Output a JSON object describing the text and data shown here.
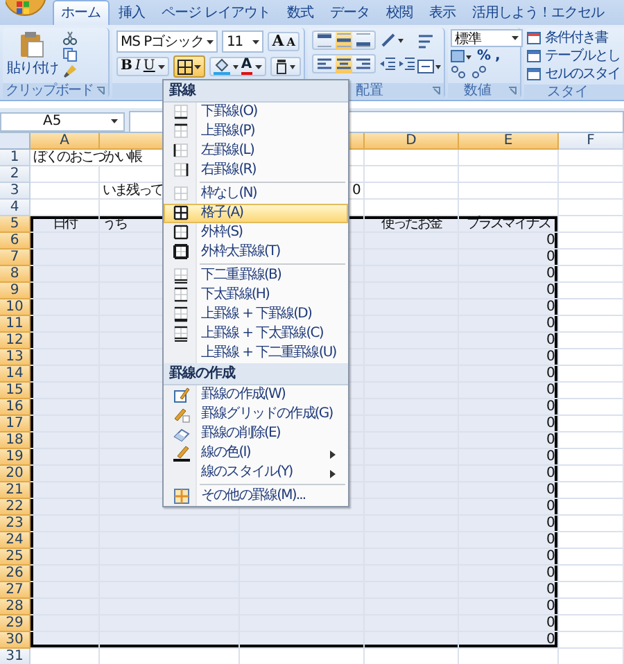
{
  "ribbon_tabs": [
    {
      "label": "ホーム",
      "selected": true
    },
    {
      "label": "挿入",
      "selected": false
    },
    {
      "label": "ページ レイアウト",
      "selected": false
    },
    {
      "label": "数式",
      "selected": false
    },
    {
      "label": "データ",
      "selected": false
    },
    {
      "label": "校閲",
      "selected": false
    },
    {
      "label": "表示",
      "selected": false
    },
    {
      "label": "活用しよう！エクセル",
      "selected": false
    }
  ],
  "ribbon": {
    "clipboard": {
      "label": "クリップボード",
      "paste": "貼り付け"
    },
    "font": {
      "font_name": "MS Pゴシック",
      "font_size": "11",
      "grow": "A",
      "shrink": "A",
      "bold": "B",
      "italic": "I",
      "underline": "U",
      "font_color": "A",
      "borders_open": true
    },
    "alignment": {
      "label": "配置",
      "vertical": [
        {
          "selected": false
        },
        {
          "selected": true
        },
        {
          "selected": false
        }
      ],
      "horizontal": [
        {
          "selected": false
        },
        {
          "selected": true
        },
        {
          "selected": false
        }
      ]
    },
    "number": {
      "label": "数値",
      "format": "標準",
      "percent": "%",
      "comma": ","
    },
    "styles": {
      "label": "スタイ",
      "items": [
        "条件付き書",
        "テーブルとし",
        "セルのスタイ"
      ]
    }
  },
  "name_box": "A5",
  "columns": [
    {
      "label": "A",
      "selected": true
    },
    {
      "selected": true
    },
    {
      "selected": true
    },
    {
      "label": "D",
      "selected": true
    },
    {
      "label": "E",
      "selected": true
    },
    {
      "label": "F",
      "selected": false
    }
  ],
  "rows": [
    {
      "number": "1",
      "selected": false,
      "cells": [
        {
          "text": "ぼくのおこづかい帳",
          "centered": false,
          "right_aligned": false
        }
      ]
    },
    {
      "number": "2",
      "selected": false
    },
    {
      "number": "3",
      "selected": false,
      "cells": [
        null,
        {
          "text": "いま残って",
          "centered": false,
          "right_aligned": false
        },
        {
          "text": "0",
          "centered": false,
          "right_aligned": true
        }
      ]
    },
    {
      "number": "4",
      "selected": false
    },
    {
      "number": "5",
      "selected": true,
      "cells": [
        {
          "text": "日付",
          "centered": true,
          "right_aligned": false
        },
        {
          "text": "うち",
          "centered": false,
          "right_aligned": false
        },
        null,
        {
          "text": "使ったお金",
          "centered": true,
          "right_aligned": false
        },
        {
          "text": "プラスマイナス",
          "centered": true,
          "right_aligned": false
        }
      ]
    },
    {
      "number": "6",
      "selected": true,
      "cells": [
        null,
        null,
        null,
        null,
        {
          "text": "0",
          "centered": false,
          "right_aligned": true
        }
      ]
    },
    {
      "number": "7",
      "selected": true,
      "cells": [
        null,
        null,
        null,
        null,
        {
          "text": "0",
          "centered": false,
          "right_aligned": true
        }
      ]
    },
    {
      "number": "8",
      "selected": true,
      "cells": [
        null,
        null,
        null,
        null,
        {
          "text": "0",
          "centered": false,
          "right_aligned": true
        }
      ]
    },
    {
      "number": "9",
      "selected": true,
      "cells": [
        null,
        null,
        null,
        null,
        {
          "text": "0",
          "centered": false,
          "right_aligned": true
        }
      ]
    },
    {
      "number": "10",
      "selected": true,
      "cells": [
        null,
        null,
        null,
        null,
        {
          "text": "0",
          "centered": false,
          "right_aligned": true
        }
      ]
    },
    {
      "number": "11",
      "selected": true,
      "cells": [
        null,
        null,
        null,
        null,
        {
          "text": "0",
          "centered": false,
          "right_aligned": true
        }
      ]
    },
    {
      "number": "12",
      "selected": true,
      "cells": [
        null,
        null,
        null,
        null,
        {
          "text": "0",
          "centered": false,
          "right_aligned": true
        }
      ]
    },
    {
      "number": "13",
      "selected": true,
      "cells": [
        null,
        null,
        null,
        null,
        {
          "text": "0",
          "centered": false,
          "right_aligned": true
        }
      ]
    },
    {
      "number": "14",
      "selected": true,
      "cells": [
        null,
        null,
        null,
        null,
        {
          "text": "0",
          "centered": false,
          "right_aligned": true
        }
      ]
    },
    {
      "number": "15",
      "selected": true,
      "cells": [
        null,
        null,
        null,
        null,
        {
          "text": "0",
          "centered": false,
          "right_aligned": true
        }
      ]
    },
    {
      "number": "16",
      "selected": true,
      "cells": [
        null,
        null,
        null,
        null,
        {
          "text": "0",
          "centered": false,
          "right_aligned": true
        }
      ]
    },
    {
      "number": "17",
      "selected": true,
      "cells": [
        null,
        null,
        null,
        null,
        {
          "text": "0",
          "centered": false,
          "right_aligned": true
        }
      ]
    },
    {
      "number": "18",
      "selected": true,
      "cells": [
        null,
        null,
        null,
        null,
        {
          "text": "0",
          "centered": false,
          "right_aligned": true
        }
      ]
    },
    {
      "number": "19",
      "selected": true,
      "cells": [
        null,
        null,
        null,
        null,
        {
          "text": "0",
          "centered": false,
          "right_aligned": true
        }
      ]
    },
    {
      "number": "20",
      "selected": true,
      "cells": [
        null,
        null,
        null,
        null,
        {
          "text": "0",
          "centered": false,
          "right_aligned": true
        }
      ]
    },
    {
      "number": "21",
      "selected": true,
      "cells": [
        null,
        null,
        null,
        null,
        {
          "text": "0",
          "centered": false,
          "right_aligned": true
        }
      ]
    },
    {
      "number": "22",
      "selected": true,
      "cells": [
        null,
        null,
        null,
        null,
        {
          "text": "0",
          "centered": false,
          "right_aligned": true
        }
      ]
    },
    {
      "number": "23",
      "selected": true,
      "cells": [
        null,
        null,
        null,
        null,
        {
          "text": "0",
          "centered": false,
          "right_aligned": true
        }
      ]
    },
    {
      "number": "24",
      "selected": true,
      "cells": [
        null,
        null,
        null,
        null,
        {
          "text": "0",
          "centered": false,
          "right_aligned": true
        }
      ]
    },
    {
      "number": "25",
      "selected": true,
      "cells": [
        null,
        null,
        null,
        null,
        {
          "text": "0",
          "centered": false,
          "right_aligned": true
        }
      ]
    },
    {
      "number": "26",
      "selected": true,
      "cells": [
        null,
        null,
        null,
        null,
        {
          "text": "0",
          "centered": false,
          "right_aligned": true
        }
      ]
    },
    {
      "number": "27",
      "selected": true,
      "cells": [
        null,
        null,
        null,
        null,
        {
          "text": "0",
          "centered": false,
          "right_aligned": true
        }
      ]
    },
    {
      "number": "28",
      "selected": true,
      "cells": [
        null,
        null,
        null,
        null,
        {
          "text": "0",
          "centered": false,
          "right_aligned": true
        }
      ]
    },
    {
      "number": "29",
      "selected": true,
      "cells": [
        null,
        null,
        null,
        null,
        {
          "text": "0",
          "centered": false,
          "right_aligned": true
        }
      ]
    },
    {
      "number": "30",
      "selected": true,
      "cells": [
        null,
        null,
        null,
        null,
        {
          "text": "0",
          "centered": false,
          "right_aligned": true
        }
      ]
    },
    {
      "number": "31",
      "selected": false
    }
  ],
  "borders_menu": {
    "items": [
      {
        "kind": "header",
        "label": "罫線"
      },
      {
        "kind": "item",
        "label": "下罫線(O)",
        "selected": false,
        "submenu": false
      },
      {
        "kind": "item",
        "label": "上罫線(P)",
        "selected": false,
        "submenu": false
      },
      {
        "kind": "item",
        "label": "左罫線(L)",
        "selected": false,
        "submenu": false
      },
      {
        "kind": "item",
        "label": "右罫線(R)",
        "selected": false,
        "submenu": false
      },
      {
        "kind": "separator"
      },
      {
        "kind": "item",
        "label": "枠なし(N)",
        "selected": false,
        "submenu": false
      },
      {
        "kind": "item",
        "label": "格子(A)",
        "selected": true,
        "submenu": false
      },
      {
        "kind": "item",
        "label": "外枠(S)",
        "selected": false,
        "submenu": false
      },
      {
        "kind": "item",
        "label": "外枠太罫線(T)",
        "selected": false,
        "submenu": false
      },
      {
        "kind": "separator"
      },
      {
        "kind": "item",
        "label": "下二重罫線(B)",
        "selected": false,
        "submenu": false
      },
      {
        "kind": "item",
        "label": "下太罫線(H)",
        "selected": false,
        "submenu": false
      },
      {
        "kind": "item",
        "label": "上罫線 + 下罫線(D)",
        "selected": false,
        "submenu": false
      },
      {
        "kind": "item",
        "label": "上罫線 + 下太罫線(C)",
        "selected": false,
        "submenu": false
      },
      {
        "kind": "item",
        "label": "上罫線 + 下二重罫線(U)",
        "selected": false,
        "submenu": false
      },
      {
        "kind": "header",
        "label": "罫線の作成"
      },
      {
        "kind": "item",
        "label": "罫線の作成(W)",
        "selected": false,
        "submenu": false
      },
      {
        "kind": "item",
        "label": "罫線グリッドの作成(G)",
        "selected": false,
        "submenu": false
      },
      {
        "kind": "item",
        "label": "罫線の削除(E)",
        "selected": false,
        "submenu": false
      },
      {
        "kind": "item",
        "label": "線の色(I)",
        "selected": false,
        "submenu": true
      },
      {
        "kind": "item",
        "label": "線のスタイル(Y)",
        "selected": false,
        "submenu": true
      },
      {
        "kind": "separator"
      },
      {
        "kind": "item",
        "label": "その他の罫線(M)...",
        "selected": false,
        "submenu": false
      }
    ]
  }
}
